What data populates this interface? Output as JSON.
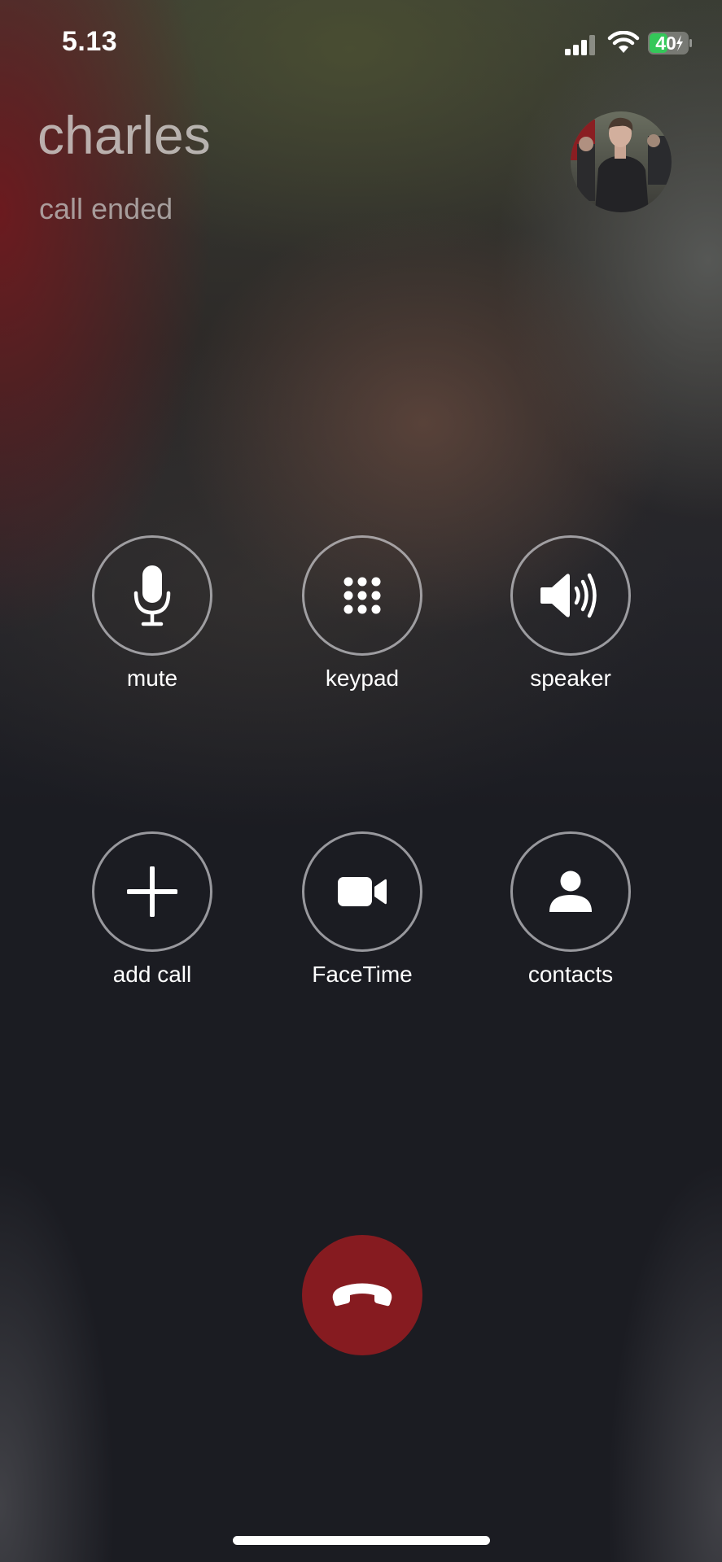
{
  "status_bar": {
    "time": "5.13",
    "battery_level": "40",
    "battery_charging": true,
    "icons": [
      "signal-icon",
      "wifi-icon",
      "battery-icon"
    ]
  },
  "call": {
    "caller_name": "charles",
    "status": "call ended"
  },
  "controls": [
    {
      "label": "mute",
      "icon": "microphone-icon"
    },
    {
      "label": "keypad",
      "icon": "keypad-icon"
    },
    {
      "label": "speaker",
      "icon": "speaker-icon"
    },
    {
      "label": "add call",
      "icon": "plus-icon"
    },
    {
      "label": "FaceTime",
      "icon": "video-camera-icon"
    },
    {
      "label": "contacts",
      "icon": "person-icon"
    }
  ],
  "end_call": {
    "icon": "phone-hangup-icon"
  },
  "colors": {
    "end_call": "#861b20",
    "battery_fill": "#34c759",
    "background": "#1b1c23"
  }
}
